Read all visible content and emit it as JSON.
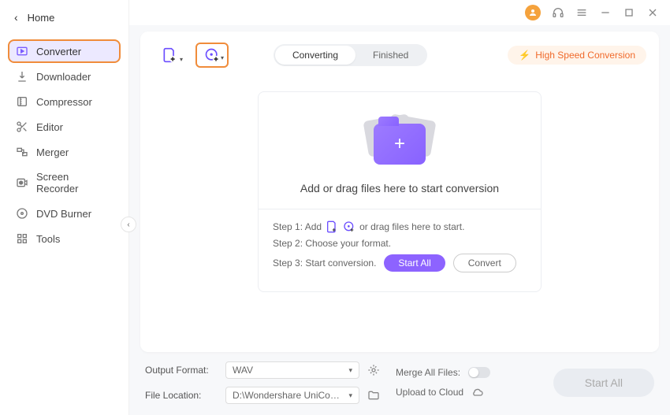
{
  "home": {
    "label": "Home"
  },
  "sidebar": {
    "items": [
      {
        "label": "Converter",
        "icon": "play-rect"
      },
      {
        "label": "Downloader",
        "icon": "download"
      },
      {
        "label": "Compressor",
        "icon": "compress"
      },
      {
        "label": "Editor",
        "icon": "scissors"
      },
      {
        "label": "Merger",
        "icon": "merge"
      },
      {
        "label": "Screen Recorder",
        "icon": "record"
      },
      {
        "label": "DVD Burner",
        "icon": "disc"
      },
      {
        "label": "Tools",
        "icon": "grid"
      }
    ]
  },
  "tabs": {
    "converting": "Converting",
    "finished": "Finished"
  },
  "hs_badge": "High Speed Conversion",
  "dropzone": {
    "title": "Add or drag files here to start conversion",
    "step1a": "Step 1: Add ",
    "step1b": " or drag files here to start.",
    "step2": "Step 2: Choose your format.",
    "step3": "Step 3: Start conversion.",
    "start_all": "Start All",
    "convert": "Convert"
  },
  "bottom": {
    "output_format_label": "Output Format:",
    "output_format_value": "WAV",
    "file_location_label": "File Location:",
    "file_location_value": "D:\\Wondershare UniConverter 1",
    "merge_label": "Merge All Files:",
    "upload_label": "Upload to Cloud",
    "start_all": "Start All"
  }
}
